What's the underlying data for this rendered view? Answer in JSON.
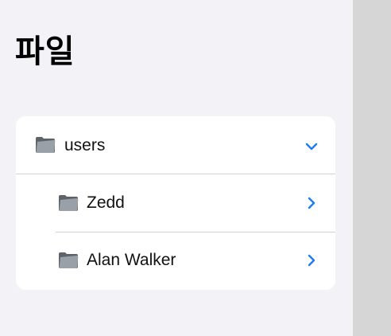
{
  "page": {
    "title": "파일"
  },
  "tree": {
    "root": {
      "label": "users",
      "icon": "folder-icon",
      "state": "expanded",
      "chevron": "chevron-down-icon"
    },
    "children": [
      {
        "label": "Zedd",
        "icon": "folder-icon",
        "chevron": "chevron-right-icon"
      },
      {
        "label": "Alan Walker",
        "icon": "folder-icon",
        "chevron": "chevron-right-icon"
      }
    ]
  },
  "colors": {
    "accent": "#1e7cf2",
    "background": "#f2f2f7",
    "card": "#ffffff",
    "detail_pane": "#d6d6d6"
  }
}
